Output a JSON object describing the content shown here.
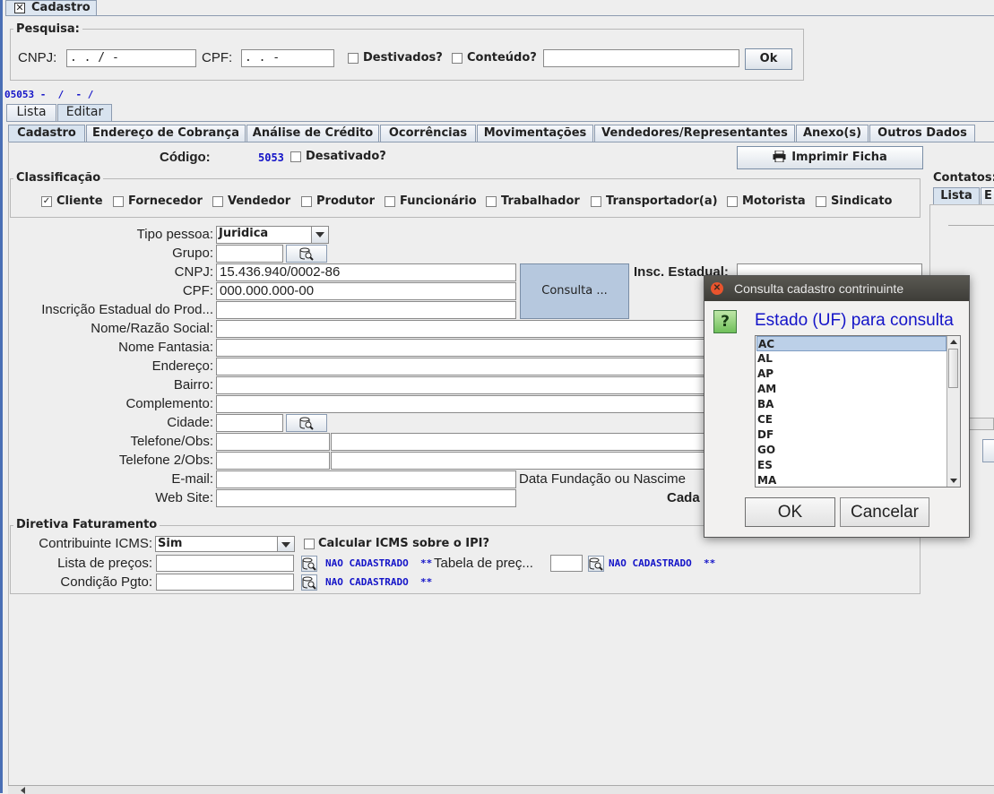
{
  "window": {
    "title": "Cadastro"
  },
  "pesquisa": {
    "group_title": "Pesquisa:",
    "cnpj_label": "CNPJ:",
    "cnpj_value": " .  .  /  -",
    "cpf_label": "CPF:",
    "cpf_value": " .  .  -",
    "desativados_label": "Destivados?",
    "conteudo_label": "Conteúdo?",
    "search_value": "",
    "ok_label": "Ok"
  },
  "status_line": "05053 -  /  - /",
  "view_tabs": [
    "Lista",
    "Editar"
  ],
  "tabs": [
    "Cadastro",
    "Endereço de Cobrança",
    "Análise de Crédito",
    "Ocorrências",
    "Movimentações",
    "Vendedores/Representantes",
    "Anexo(s)",
    "Outros Dados"
  ],
  "codigo": {
    "label": "Código:",
    "value": "5053",
    "desativado_label": "Desativado?"
  },
  "imprimir_label": "Imprimir Ficha",
  "contatos": {
    "label": "Contatos:",
    "tab_lista": "Lista",
    "tab_partial": "E"
  },
  "classificacao": {
    "title": "Classificação",
    "items": [
      {
        "label": "Cliente",
        "checked": true
      },
      {
        "label": "Fornecedor",
        "checked": false
      },
      {
        "label": "Vendedor",
        "checked": false
      },
      {
        "label": "Produtor",
        "checked": false
      },
      {
        "label": "Funcionário",
        "checked": false
      },
      {
        "label": "Trabalhador",
        "checked": false
      },
      {
        "label": "Transportador(a)",
        "checked": false
      },
      {
        "label": "Motorista",
        "checked": false
      },
      {
        "label": "Sindicato",
        "checked": false
      }
    ]
  },
  "form": {
    "tipo_pessoa_label": "Tipo pessoa:",
    "tipo_pessoa_value": "Juridica",
    "grupo_label": "Grupo:",
    "cnpj_label": "CNPJ:",
    "cnpj_value": "15.436.940/0002-86",
    "cpf_label": "CPF:",
    "cpf_value": "000.000.000-00",
    "consulta_label": "Consulta ...",
    "insc_estadual_label": "Insc. Estadual:",
    "insc_prod_label": "Inscrição Estadual do  Prod...",
    "nome_label": "Nome/Razão Social:",
    "fantasia_label": "Nome Fantasia:",
    "endereco_label": "Endereço:",
    "bairro_label": "Bairro:",
    "complemento_label": "Complemento:",
    "cidade_label": "Cidade:",
    "telefone_label": "Telefone/Obs:",
    "telefone2_label": "Telefone 2/Obs:",
    "email_label": "E-mail:",
    "fundacao_label": "Data Fundação ou Nascime",
    "website_label": "Web Site:",
    "cada_label": "Cada"
  },
  "faturamento": {
    "title": "Diretiva Faturamento",
    "icms_label": "Contribuinte ICMS:",
    "icms_value": "Sim",
    "calc_icms_label": "Calcular ICMS sobre o IPI?",
    "lista_label": "Lista de preços:",
    "lista_status": "NAO CADASTRADO  **",
    "tabela_label": "Tabela de preç...",
    "tabela_status": "NAO CADASTRADO  **",
    "condicao_label": "Condição Pgto:",
    "condicao_status": "NAO CADASTRADO  **"
  },
  "dialog": {
    "title": "Consulta cadastro contrinuinte",
    "prompt": "Estado (UF) para consulta",
    "options": [
      "AC",
      "AL",
      "AP",
      "AM",
      "BA",
      "CE",
      "DF",
      "GO",
      "ES",
      "MA"
    ],
    "selected": "AC",
    "ok_label": "OK",
    "cancel_label": "Cancelar"
  },
  "colors": {
    "accent_blue": "#1414c8",
    "dialog_title_bg": "#3e3d38",
    "selection": "#bcd0e8"
  }
}
